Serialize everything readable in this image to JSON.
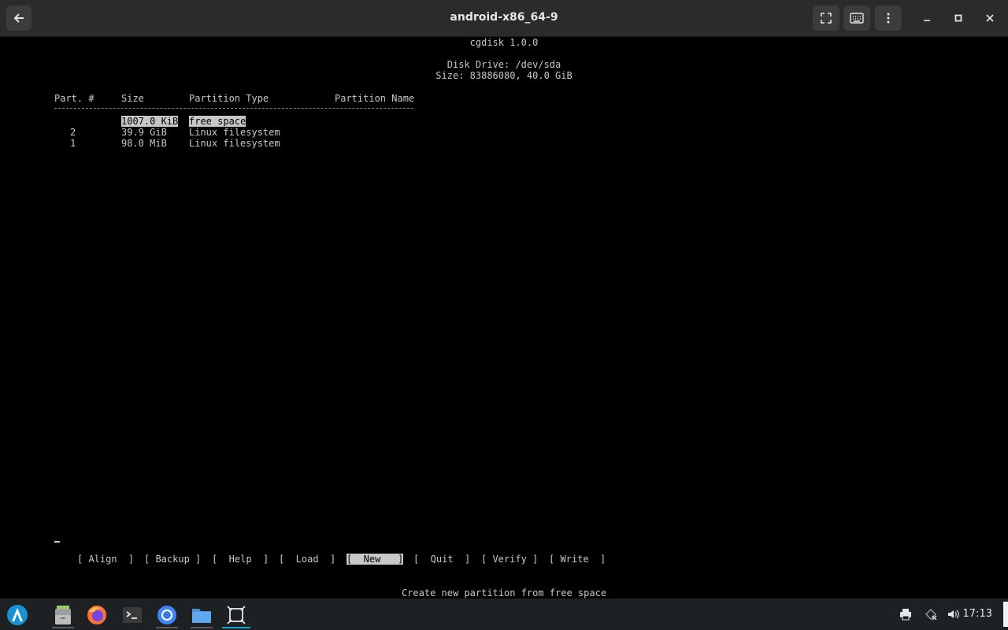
{
  "window": {
    "title": "android-x86_64-9",
    "icons": [
      "back-arrow-icon",
      "fullscreen-icon",
      "keyboard-icon",
      "more-vertical-icon",
      "minimize-icon",
      "maximize-icon",
      "close-icon"
    ]
  },
  "cgdisk": {
    "header": "cgdisk 1.0.0",
    "disk_drive": "Disk Drive: /dev/sda",
    "size": "Size: 83886080, 40.0 GiB",
    "columns": {
      "part": "Part. #",
      "size": "Size",
      "type": "Partition Type",
      "name": "Partition Name"
    },
    "rows": [
      {
        "part": "",
        "size": "1007.0 KiB",
        "type": "free space",
        "name": "",
        "selected": true
      },
      {
        "part": "2",
        "size": "39.9 GiB",
        "type": "Linux filesystem",
        "name": ""
      },
      {
        "part": "1",
        "size": "98.0 MiB",
        "type": "Linux filesystem",
        "name": ""
      }
    ],
    "menu": [
      {
        "label": "[ Align  ]",
        "selected": false
      },
      {
        "label": "[ Backup ]",
        "selected": false
      },
      {
        "label": "[  Help  ]",
        "selected": false
      },
      {
        "label": "[  Load  ]",
        "selected": false
      },
      {
        "label": "[  New   ]",
        "selected": true
      },
      {
        "label": "[  Quit  ]",
        "selected": false
      },
      {
        "label": "[ Verify ]",
        "selected": false
      },
      {
        "label": "[ Write  ]",
        "selected": false
      }
    ],
    "hint": "Create new partition from free space"
  },
  "taskbar": {
    "apps": [
      "start-menu-icon",
      "file-manager-icon",
      "firefox-icon",
      "terminal-icon",
      "chromium-icon",
      "folder-icon",
      "screenshot-icon"
    ],
    "tray": [
      "printer-icon",
      "network-icon",
      "volume-icon"
    ],
    "clock": "17:13"
  },
  "colors": {
    "titlebar": "#2b2b2b",
    "terminal_bg": "#000000",
    "terminal_fg": "#c8c8c8",
    "taskbar": "#1e2124",
    "accent": "#17a2d4"
  }
}
